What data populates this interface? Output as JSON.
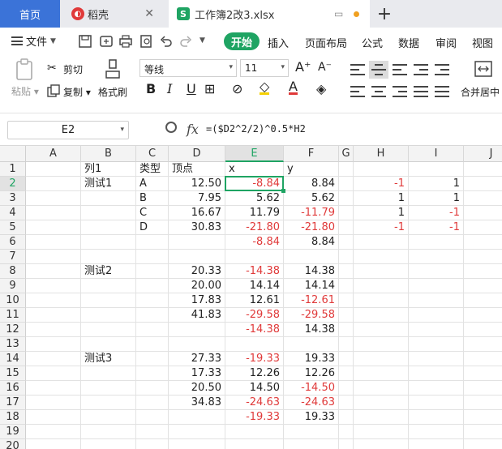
{
  "tabs": {
    "home": "首页",
    "daoke": "稻壳",
    "file": "工作簿2改3.xlsx"
  },
  "menu": {
    "file": "文件",
    "start": "开始",
    "items": [
      "插入",
      "页面布局",
      "公式",
      "数据",
      "审阅",
      "视图"
    ]
  },
  "ribbon": {
    "paste": "粘贴",
    "cut": "剪切",
    "copy": "复制",
    "format_painter": "格式刷",
    "font_name": "等线",
    "font_size": "11",
    "merge_center": "合并居中"
  },
  "formula_bar": {
    "name_box": "E2",
    "formula": "=($D2^2/2)^0.5*H2"
  },
  "columns": [
    "A",
    "B",
    "C",
    "D",
    "E",
    "F",
    "G",
    "H",
    "I",
    "J"
  ],
  "active_cell": "E2",
  "rows": [
    {
      "n": "1",
      "B": "列1",
      "C": "类型",
      "D": "顶点",
      "E": "x",
      "F": "y",
      "H": "",
      "I": ""
    },
    {
      "n": "2",
      "B": "测试1",
      "C": "A",
      "D": "12.50",
      "E": "-8.84",
      "F": "8.84",
      "H": "-1",
      "I": "1"
    },
    {
      "n": "3",
      "B": "",
      "C": "B",
      "D": "7.95",
      "E": "5.62",
      "F": "5.62",
      "H": "1",
      "I": "1"
    },
    {
      "n": "4",
      "B": "",
      "C": "C",
      "D": "16.67",
      "E": "11.79",
      "F": "-11.79",
      "H": "1",
      "I": "-1"
    },
    {
      "n": "5",
      "B": "",
      "C": "D",
      "D": "30.83",
      "E": "-21.80",
      "F": "-21.80",
      "H": "-1",
      "I": "-1"
    },
    {
      "n": "6",
      "B": "",
      "C": "",
      "D": "",
      "E": "-8.84",
      "F": "8.84",
      "H": "",
      "I": ""
    },
    {
      "n": "7",
      "B": "",
      "C": "",
      "D": "",
      "E": "",
      "F": "",
      "H": "",
      "I": ""
    },
    {
      "n": "8",
      "B": "测试2",
      "C": "",
      "D": "20.33",
      "E": "-14.38",
      "F": "14.38",
      "H": "",
      "I": ""
    },
    {
      "n": "9",
      "B": "",
      "C": "",
      "D": "20.00",
      "E": "14.14",
      "F": "14.14",
      "H": "",
      "I": ""
    },
    {
      "n": "10",
      "B": "",
      "C": "",
      "D": "17.83",
      "E": "12.61",
      "F": "-12.61",
      "H": "",
      "I": ""
    },
    {
      "n": "11",
      "B": "",
      "C": "",
      "D": "41.83",
      "E": "-29.58",
      "F": "-29.58",
      "H": "",
      "I": ""
    },
    {
      "n": "12",
      "B": "",
      "C": "",
      "D": "",
      "E": "-14.38",
      "F": "14.38",
      "H": "",
      "I": ""
    },
    {
      "n": "13",
      "B": "",
      "C": "",
      "D": "",
      "E": "",
      "F": "",
      "H": "",
      "I": ""
    },
    {
      "n": "14",
      "B": "测试3",
      "C": "",
      "D": "27.33",
      "E": "-19.33",
      "F": "19.33",
      "H": "",
      "I": ""
    },
    {
      "n": "15",
      "B": "",
      "C": "",
      "D": "17.33",
      "E": "12.26",
      "F": "12.26",
      "H": "",
      "I": ""
    },
    {
      "n": "16",
      "B": "",
      "C": "",
      "D": "20.50",
      "E": "14.50",
      "F": "-14.50",
      "H": "",
      "I": ""
    },
    {
      "n": "17",
      "B": "",
      "C": "",
      "D": "34.83",
      "E": "-24.63",
      "F": "-24.63",
      "H": "",
      "I": ""
    },
    {
      "n": "18",
      "B": "",
      "C": "",
      "D": "",
      "E": "-19.33",
      "F": "19.33",
      "H": "",
      "I": ""
    },
    {
      "n": "19",
      "B": "",
      "C": "",
      "D": "",
      "E": "",
      "F": "",
      "H": "",
      "I": ""
    },
    {
      "n": "20",
      "B": "",
      "C": "",
      "D": "",
      "E": "",
      "F": "",
      "H": "",
      "I": ""
    }
  ],
  "colors": {
    "accent_green": "#1fa463",
    "negative_red": "#e03a3a",
    "home_tab_blue": "#3b73d8"
  }
}
